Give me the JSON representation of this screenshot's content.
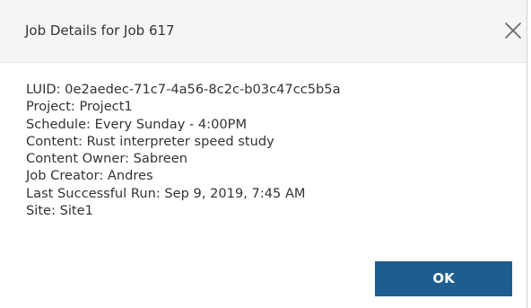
{
  "dialog": {
    "title": "Job Details for Job 617",
    "close_icon": "close-icon",
    "details": [
      "LUID: 0e2aedec-71c7-4a56-8c2c-b03c47cc5b5a",
      "Project: Project1",
      "Schedule: Every Sunday - 4:00PM",
      "Content: Rust interpreter speed study",
      "Content Owner: Sabreen",
      "Job Creator: Andres",
      "Last Successful Run: Sep 9, 2019, 7:45 AM",
      "Site: Site1"
    ],
    "ok_label": "OK"
  },
  "colors": {
    "header_background": "#f5f5f5",
    "primary_button": "#1f5d8f",
    "text": "#333333"
  }
}
